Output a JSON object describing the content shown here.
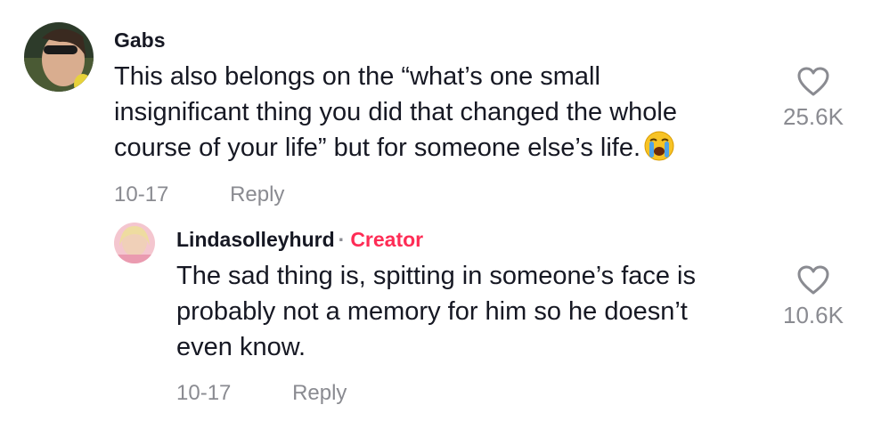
{
  "comments": [
    {
      "username": "Gabs",
      "text_lines": [
        "This also belongs on the “what’s one small",
        "insignificant thing you did that changed the whole",
        "course of your life” but for someone else’s life."
      ],
      "emoji": "loudly-crying-face",
      "date": "10-17",
      "reply_label": "Reply",
      "likes": "25.6K"
    },
    {
      "username": "Lindasolleyhurd",
      "separator": "·",
      "badge": "Creator",
      "text_lines": [
        "The sad thing is, spitting in someone’s face is",
        "probably not a memory for him so he doesn’t",
        "even know."
      ],
      "date": "10-17",
      "reply_label": "Reply",
      "likes": "10.6K"
    }
  ],
  "colors": {
    "text": "#161823",
    "muted": "#8a8b91",
    "creator_badge": "#fe2c55"
  }
}
